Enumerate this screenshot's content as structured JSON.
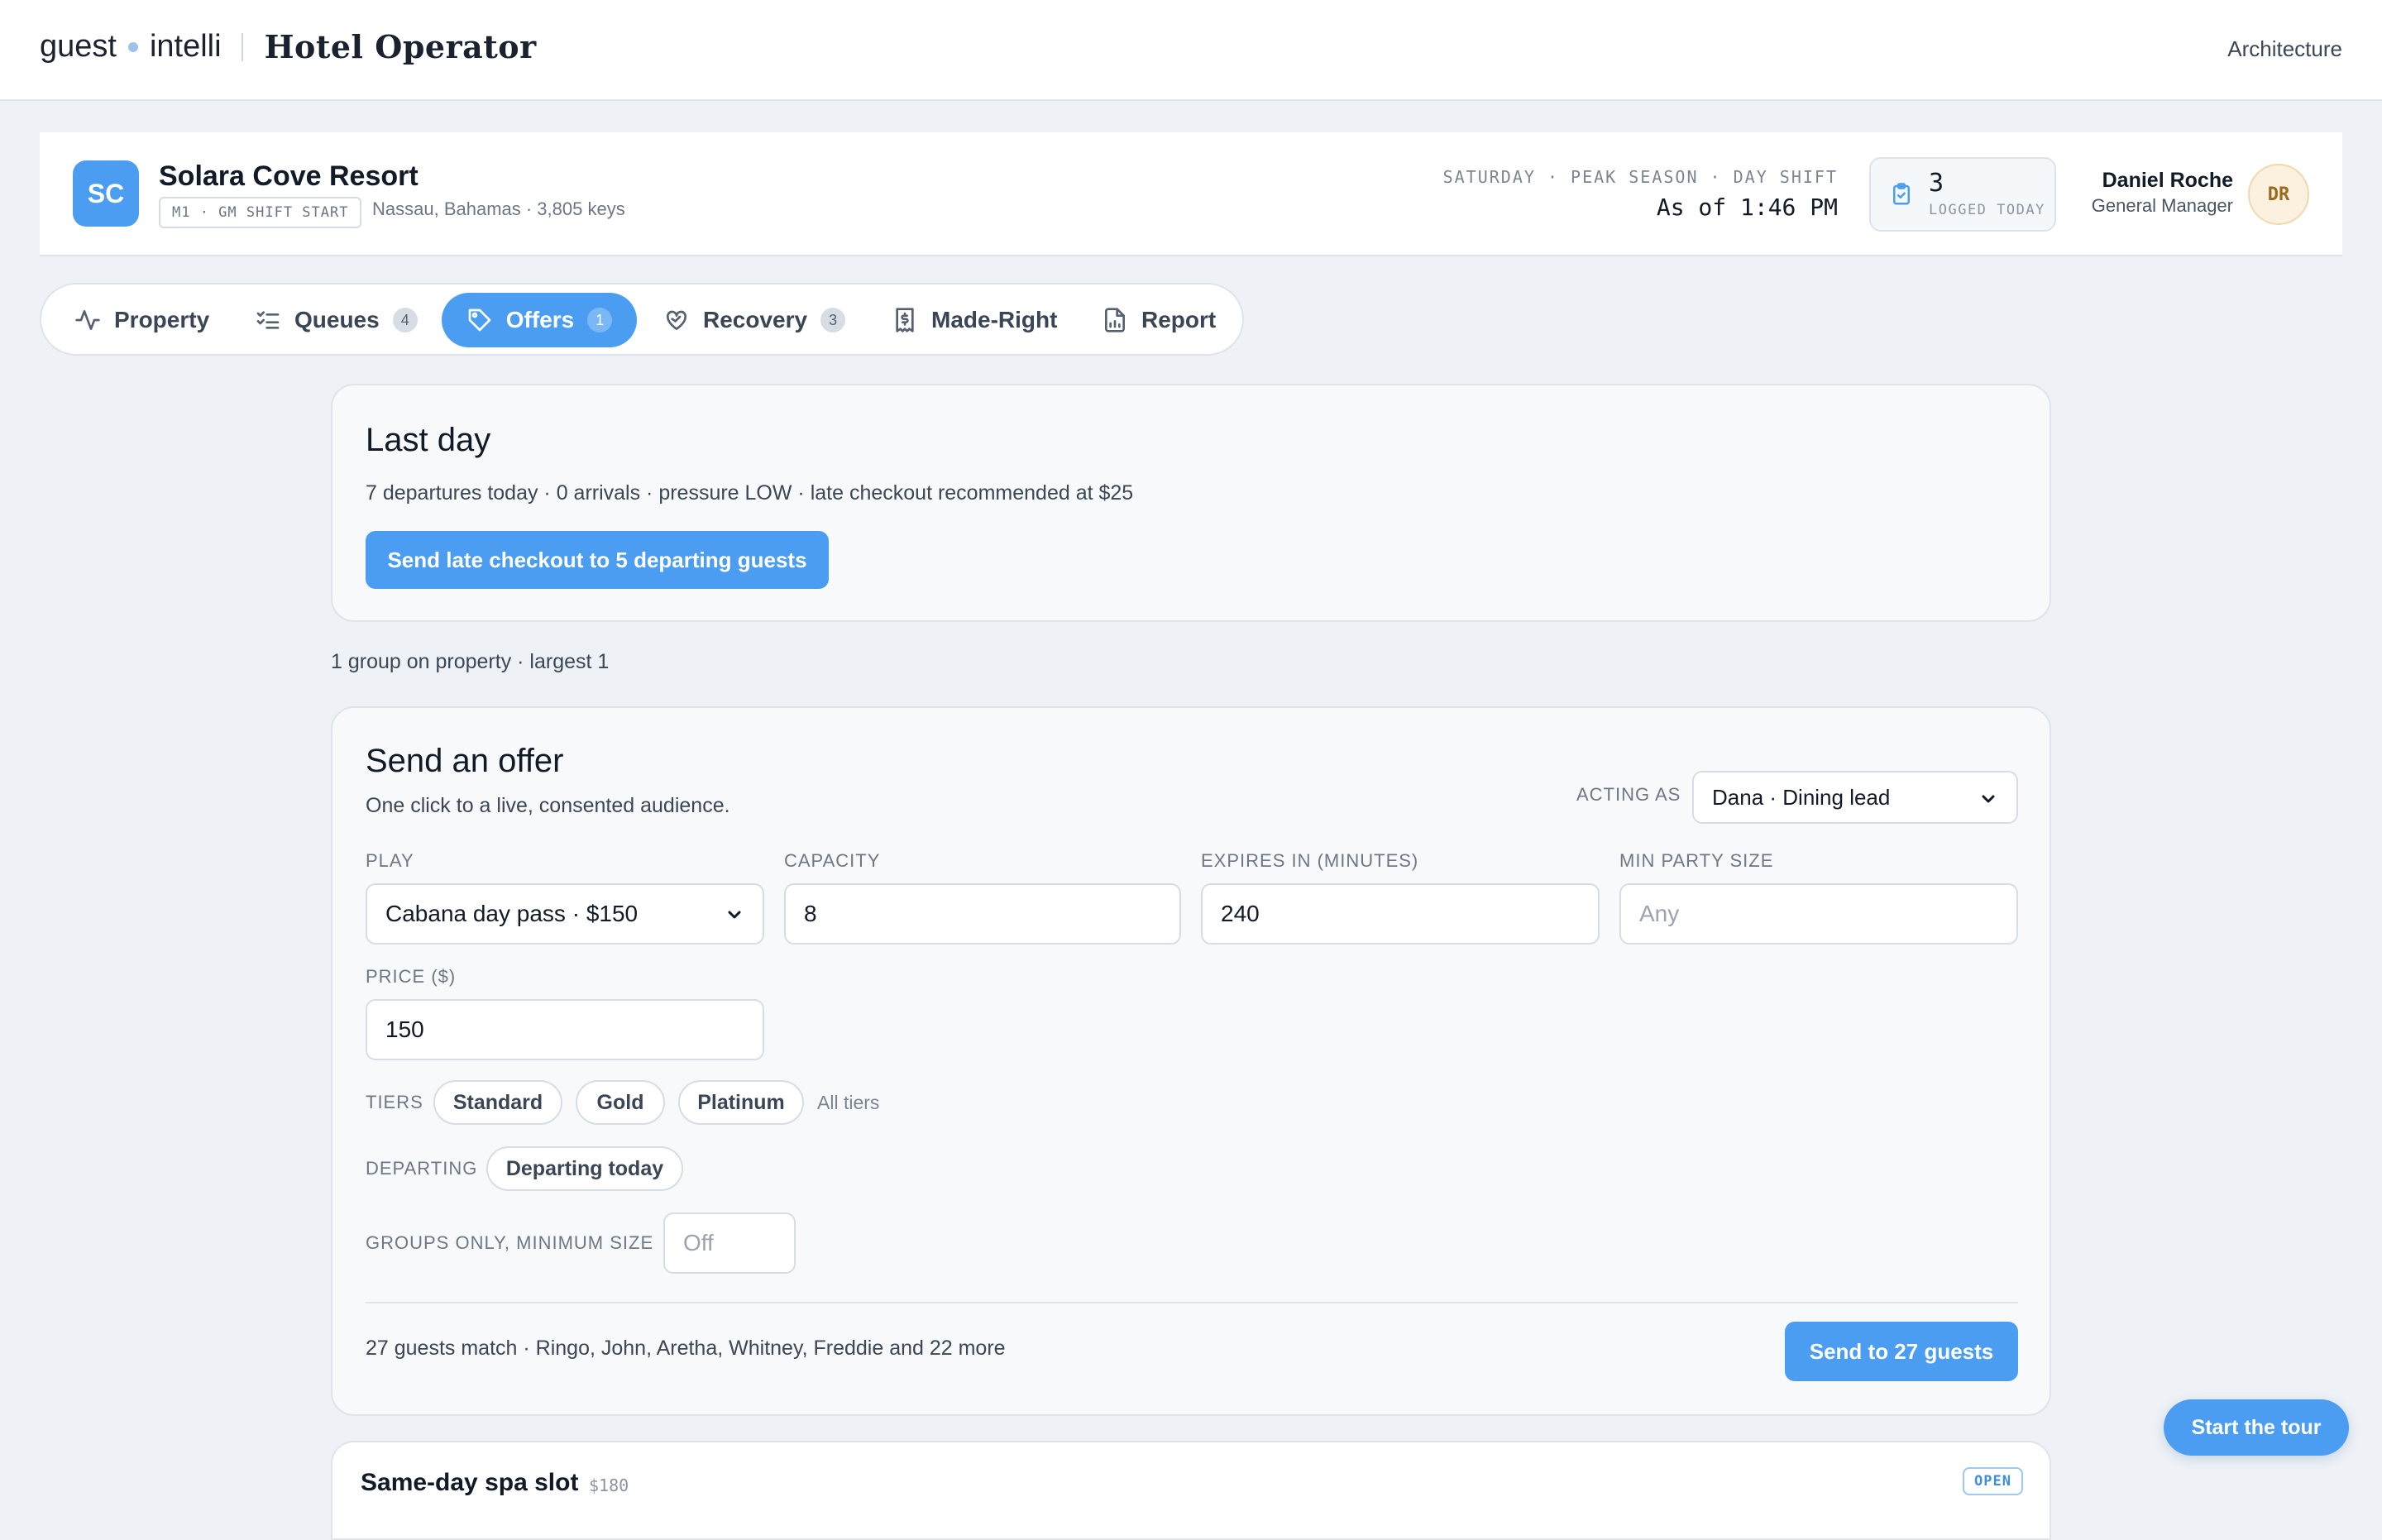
{
  "brand": {
    "part1": "guest",
    "part2": "intelli",
    "product": "Hotel Operator"
  },
  "nav": {
    "architecture": "Architecture"
  },
  "property": {
    "initials": "SC",
    "name": "Solara Cove Resort",
    "badge": "M1 · GM SHIFT START",
    "location": "Nassau, Bahamas · 3,805 keys",
    "shift_line": "SATURDAY · PEAK SEASON · DAY SHIFT",
    "as_of": "As of 1:46 PM",
    "logged_count": "3",
    "logged_label": "LOGGED TODAY",
    "user_name": "Daniel Roche",
    "user_role": "General Manager",
    "user_initials": "DR"
  },
  "tabs": [
    {
      "label": "Property",
      "icon": "activity-icon",
      "count": null
    },
    {
      "label": "Queues",
      "icon": "checklist-icon",
      "count": "4"
    },
    {
      "label": "Offers",
      "icon": "tag-icon",
      "count": "1",
      "active": true
    },
    {
      "label": "Recovery",
      "icon": "heart-handshake-icon",
      "count": "3"
    },
    {
      "label": "Made-Right",
      "icon": "receipt-icon",
      "count": null
    },
    {
      "label": "Report",
      "icon": "file-chart-icon",
      "count": null
    }
  ],
  "last_day": {
    "title": "Last day",
    "summary": "7 departures today · 0 arrivals · pressure LOW · late checkout recommended at $25",
    "button": "Send late checkout to 5 departing guests"
  },
  "groups_line": "1 group on property · largest 1",
  "offer": {
    "title": "Send an offer",
    "subtitle": "One click to a live, consented audience.",
    "acting_as_label": "ACTING AS",
    "acting_as_value": "Dana · Dining lead",
    "play_label": "PLAY",
    "play_value": "Cabana day pass · $150",
    "capacity_label": "CAPACITY",
    "capacity_value": "8",
    "expires_label": "EXPIRES IN (MINUTES)",
    "expires_value": "240",
    "min_party_label": "MIN PARTY SIZE",
    "min_party_placeholder": "Any",
    "price_label": "PRICE ($)",
    "price_value": "150",
    "tiers_label": "TIERS",
    "tiers": [
      "Standard",
      "Gold",
      "Platinum"
    ],
    "tiers_hint": "All tiers",
    "departing_label": "DEPARTING",
    "departing_chip": "Departing today",
    "groups_label": "GROUPS ONLY, MINIMUM SIZE",
    "groups_placeholder": "Off",
    "match_text": "27 guests match · Ringo, John, Aretha, Whitney, Freddie and 22 more",
    "send_button": "Send to 27 guests"
  },
  "next_offer": {
    "title": "Same-day spa slot",
    "price": "$180",
    "status": "OPEN"
  },
  "tour_button": "Start the tour",
  "colors": {
    "accent": "#4a9df0",
    "background": "#eef2f6",
    "avatar_dr": "#fbf1de"
  }
}
